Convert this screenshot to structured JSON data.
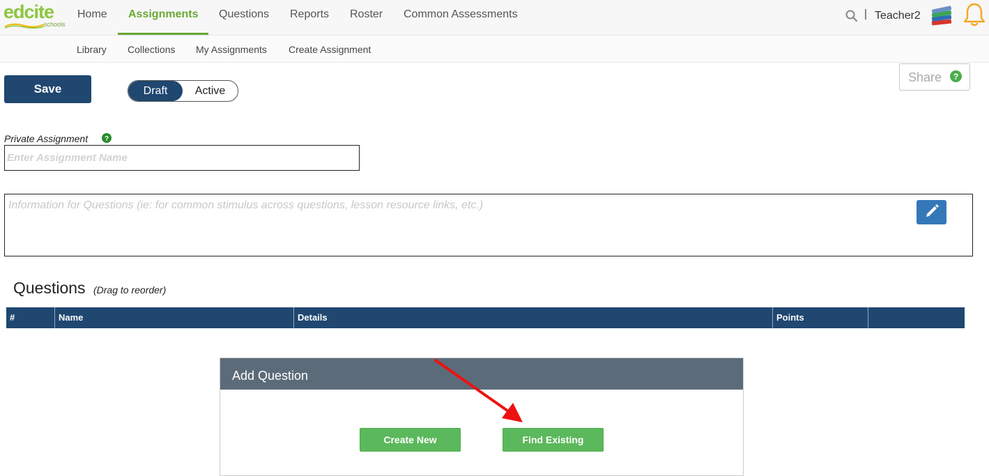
{
  "brand": {
    "name": "edcite",
    "sub": "schools"
  },
  "nav": {
    "items": [
      {
        "label": "Home"
      },
      {
        "label": "Assignments"
      },
      {
        "label": "Questions"
      },
      {
        "label": "Reports"
      },
      {
        "label": "Roster"
      },
      {
        "label": "Common Assessments"
      }
    ],
    "active": "Assignments",
    "user": "Teacher2"
  },
  "subnav": {
    "items": [
      {
        "label": "Library"
      },
      {
        "label": "Collections"
      },
      {
        "label": "My Assignments"
      },
      {
        "label": "Create Assignment"
      }
    ]
  },
  "toolbar": {
    "save_label": "Save",
    "status_options": [
      "Draft",
      "Active"
    ],
    "status_selected": "Draft",
    "share_label": "Share"
  },
  "form": {
    "privacy_label": "Private Assignment",
    "name_placeholder": "Enter Assignment Name",
    "name_value": "",
    "info_placeholder": "Information for Questions (ie: for common stimulus across questions, lesson resource links, etc.)"
  },
  "questions": {
    "title": "Questions",
    "hint": "(Drag to reorder)",
    "columns": [
      "#",
      "Name",
      "Details",
      "Points",
      ""
    ]
  },
  "add_question": {
    "title": "Add Question",
    "create_label": "Create New",
    "find_label": "Find Existing"
  },
  "colors": {
    "navy": "#1f4770",
    "green": "#5cb85c",
    "nav_active": "#6aa834",
    "panel_header": "#5c6b79",
    "annotation_arrow": "#ee1111"
  }
}
